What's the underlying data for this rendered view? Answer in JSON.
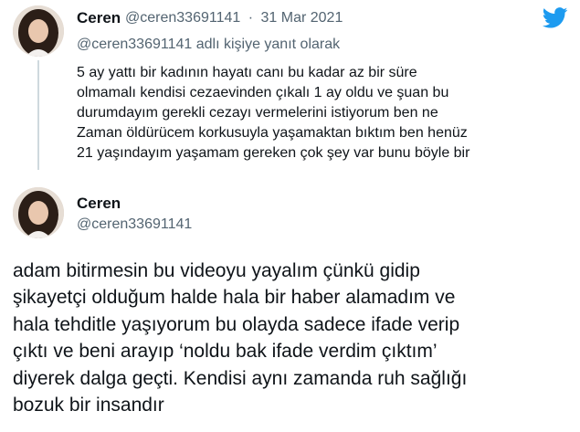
{
  "brand": {
    "icon": "twitter-bird-icon",
    "color": "#1d9bf0"
  },
  "tweet1": {
    "author_name": "Ceren",
    "author_handle": "@ceren33691141",
    "separator": "·",
    "date": "31 Mar 2021",
    "reply_context": "@ceren33691141 adlı kişiye yanıt olarak",
    "text_lines": [
      "5 ay yattı bir kadının hayatı canı bu kadar az bir süre",
      "olmamalı kendisi cezaevinden çıkalı 1 ay oldu ve şuan bu",
      "durumdayım gerekli cezayı vermelerini istiyorum ben ne",
      "Zaman öldürücem korkusuyla yaşamaktan bıktım ben henüz",
      "21 yaşındayım yaşamam gereken çok şey var bunu böyle bir"
    ]
  },
  "tweet2": {
    "author_name": "Ceren",
    "author_handle": "@ceren33691141",
    "text_lines": [
      "adam bitirmesin bu videoyu yayalım çünkü gidip",
      "şikayetçi olduğum halde hala bir haber alamadım ve",
      "hala tehditle yaşıyorum bu olayda sadece ifade verip",
      "çıktı ve beni arayıp ‘noldu bak ifade verdim çıktım’",
      "diyerek dalga geçti. Kendisi aynı zamanda ruh sağlığı",
      "bozuk bir insandır"
    ]
  }
}
